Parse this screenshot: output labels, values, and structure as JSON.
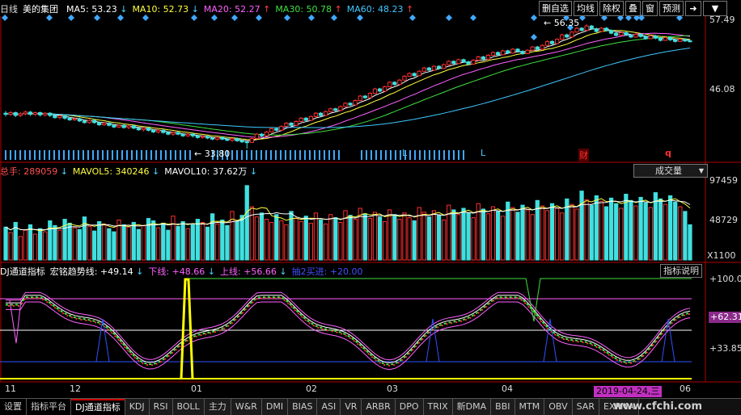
{
  "main_legend": {
    "period": "日线",
    "stock_name": "美的集团",
    "ma5": {
      "label": "MA5: 53.23",
      "arrow": "↓",
      "color": "#ffffff",
      "arrow_color": "#4fd4ff"
    },
    "ma10": {
      "label": "MA10: 52.73",
      "arrow": "↓",
      "color": "#ffff40",
      "arrow_color": "#4fd4ff"
    },
    "ma20": {
      "label": "MA20: 52.27",
      "arrow": "↑",
      "color": "#ff60ff",
      "arrow_color": "#ff4040"
    },
    "ma30": {
      "label": "MA30: 50.78",
      "arrow": "↑",
      "color": "#40e040",
      "arrow_color": "#ff4040"
    },
    "ma60": {
      "label": "MA60: 48.23",
      "arrow": "↑",
      "color": "#40c8ff",
      "arrow_color": "#ff4040"
    }
  },
  "toolbar": {
    "buttons": [
      "删自选",
      "均线",
      "除权",
      "叠",
      "窗",
      "预测"
    ],
    "icon_name": "exit-arrow-icon",
    "icon_glyph": "➜",
    "dropdown_glyph": "▼"
  },
  "price_axis": {
    "top": "57.49",
    "bottom": "46.08"
  },
  "volume_legend": {
    "total": {
      "label": "总手: 289059",
      "arrow": "↓",
      "color": "#ff5050",
      "arrow_color": "#4fd4ff"
    },
    "mavol5": {
      "label": "MAVOL5: 340246",
      "arrow": "↓",
      "color": "#ffff40",
      "arrow_color": "#4fd4ff"
    },
    "mavol10": {
      "label": "MAVOL10: 37.62万",
      "arrow": "↓",
      "color": "#ffffff",
      "arrow_color": "#4fd4ff"
    },
    "selector": "成交量",
    "selector_arrow": "▼"
  },
  "volume_axis": {
    "top": "97459",
    "mid": "48729",
    "unit": "X1100"
  },
  "indicator_legend": {
    "name": {
      "label": "DJ通道指标",
      "color": "#ffffff"
    },
    "trend": {
      "label": "宏铭趋势线: +49.14",
      "arrow": "↓",
      "color": "#ffffff",
      "arrow_color": "#4fd4ff"
    },
    "lower": {
      "label": "下线: +48.66",
      "arrow": "↓",
      "color": "#ff60ff",
      "arrow_color": "#4fd4ff"
    },
    "upper": {
      "label": "上线: +56.66",
      "arrow": "↓",
      "color": "#ff60ff",
      "arrow_color": "#4fd4ff"
    },
    "buy": {
      "label": "抽2买进: +20.00",
      "color": "#4050ff"
    },
    "help": "指标说明"
  },
  "indicator_axis": {
    "top": "+100.0",
    "current": "+62.31",
    "low": "+33.85"
  },
  "x_axis": {
    "labels": [
      "11",
      "12",
      "01",
      "02",
      "03",
      "04",
      "06"
    ],
    "date_badge": "2019-04-24,三"
  },
  "annotations": {
    "high_label": "56.35",
    "low_label": "33.80",
    "marker_cai": "财",
    "marker_l1": "L",
    "marker_l2": "L",
    "marker_q": "q"
  },
  "tabs": [
    "设置",
    "指标平台",
    "DJ通道指标",
    "KDJ",
    "RSI",
    "BOLL",
    "主力",
    "W&R",
    "DMI",
    "BIAS",
    "ASI",
    "VR",
    "ARBR",
    "DPO",
    "TRIX",
    "新DMA",
    "BBI",
    "MTM",
    "OBV",
    "SAR",
    "EXPMA"
  ],
  "active_tab": "DJ通道指标",
  "watermark": "www.cfchi.com",
  "chart_data": {
    "type": "candlestick",
    "title": "美的集团",
    "ylim": [
      44.0,
      58.5
    ],
    "price_labels": [
      57.49,
      46.08
    ],
    "candles": [
      [
        40.2,
        40.0,
        40.6,
        39.6
      ],
      [
        40.0,
        40.3,
        40.6,
        39.7
      ],
      [
        40.3,
        39.8,
        40.5,
        39.5
      ],
      [
        39.8,
        40.1,
        40.4,
        39.5
      ],
      [
        40.1,
        40.4,
        40.7,
        39.8
      ],
      [
        40.4,
        40.0,
        40.6,
        39.7
      ],
      [
        40.0,
        40.3,
        40.5,
        39.7
      ],
      [
        40.3,
        39.9,
        40.5,
        39.6
      ],
      [
        39.9,
        40.2,
        40.4,
        39.6
      ],
      [
        40.2,
        39.8,
        40.4,
        39.5
      ],
      [
        39.8,
        39.4,
        40.0,
        39.2
      ],
      [
        39.4,
        39.7,
        39.9,
        39.1
      ],
      [
        39.7,
        39.3,
        39.9,
        39.0
      ],
      [
        39.3,
        39.0,
        39.5,
        38.8
      ],
      [
        39.0,
        39.2,
        39.4,
        38.8
      ],
      [
        39.2,
        38.8,
        39.4,
        38.6
      ],
      [
        38.8,
        38.5,
        39.0,
        38.3
      ],
      [
        38.5,
        38.9,
        39.1,
        38.3
      ],
      [
        38.9,
        38.5,
        39.1,
        38.3
      ],
      [
        38.5,
        38.1,
        38.7,
        37.9
      ],
      [
        38.1,
        38.4,
        38.6,
        37.9
      ],
      [
        38.4,
        38.0,
        38.6,
        37.8
      ],
      [
        38.0,
        37.7,
        38.2,
        37.5
      ],
      [
        37.7,
        38.0,
        38.2,
        37.5
      ],
      [
        38.0,
        37.6,
        38.2,
        37.4
      ],
      [
        37.6,
        37.9,
        38.1,
        37.3
      ],
      [
        37.9,
        37.5,
        38.1,
        37.3
      ],
      [
        37.5,
        37.2,
        37.7,
        37.0
      ],
      [
        37.2,
        37.5,
        37.7,
        36.9
      ],
      [
        37.5,
        37.1,
        37.7,
        36.9
      ],
      [
        37.1,
        36.8,
        37.3,
        36.6
      ],
      [
        36.8,
        37.1,
        37.3,
        36.5
      ],
      [
        37.1,
        36.7,
        37.3,
        36.5
      ],
      [
        36.7,
        36.4,
        36.9,
        36.2
      ],
      [
        36.4,
        36.7,
        36.9,
        36.1
      ],
      [
        36.7,
        36.4,
        36.9,
        36.2
      ],
      [
        36.4,
        36.1,
        36.6,
        35.9
      ],
      [
        36.1,
        36.4,
        36.6,
        35.9
      ],
      [
        36.4,
        36.1,
        36.6,
        35.8
      ],
      [
        36.1,
        35.8,
        36.3,
        35.6
      ],
      [
        35.8,
        36.0,
        36.2,
        35.6
      ],
      [
        36.0,
        35.7,
        36.2,
        35.5
      ],
      [
        35.7,
        35.5,
        35.9,
        35.3
      ],
      [
        35.5,
        35.8,
        36.0,
        35.2
      ],
      [
        35.8,
        35.5,
        36.0,
        35.3
      ],
      [
        35.5,
        35.3,
        35.7,
        35.1
      ],
      [
        35.3,
        35.6,
        35.8,
        35.0
      ],
      [
        35.6,
        35.2,
        35.8,
        35.0
      ],
      [
        35.2,
        35.0,
        35.4,
        34.8
      ],
      [
        35.0,
        34.9,
        35.2,
        33.8
      ],
      [
        34.9,
        35.6,
        35.8,
        34.8
      ],
      [
        35.6,
        36.4,
        36.6,
        35.5
      ],
      [
        36.4,
        36.1,
        36.6,
        35.9
      ],
      [
        36.1,
        36.8,
        37.0,
        36.0
      ],
      [
        36.8,
        37.4,
        37.6,
        36.7
      ],
      [
        37.4,
        37.1,
        37.6,
        36.9
      ],
      [
        37.1,
        37.8,
        38.0,
        37.0
      ],
      [
        37.8,
        38.4,
        38.6,
        37.7
      ],
      [
        38.4,
        38.0,
        38.6,
        37.8
      ],
      [
        38.0,
        38.7,
        38.9,
        37.9
      ],
      [
        38.7,
        39.3,
        39.5,
        38.6
      ],
      [
        39.3,
        38.9,
        39.5,
        38.7
      ],
      [
        38.9,
        39.6,
        39.8,
        38.8
      ],
      [
        39.6,
        40.2,
        40.4,
        39.5
      ],
      [
        40.2,
        39.8,
        40.4,
        39.6
      ],
      [
        39.8,
        40.5,
        40.7,
        39.7
      ],
      [
        40.5,
        41.0,
        41.2,
        40.4
      ],
      [
        41.0,
        40.7,
        41.2,
        40.5
      ],
      [
        40.7,
        41.4,
        41.6,
        40.6
      ],
      [
        41.4,
        42.0,
        42.2,
        41.3
      ],
      [
        42.0,
        41.7,
        42.2,
        41.5
      ],
      [
        41.7,
        42.5,
        42.7,
        41.6
      ],
      [
        42.5,
        43.3,
        43.5,
        42.4
      ],
      [
        43.3,
        43.0,
        43.5,
        42.8
      ],
      [
        43.0,
        43.8,
        44.0,
        42.9
      ],
      [
        43.8,
        44.6,
        44.8,
        43.7
      ],
      [
        44.6,
        44.2,
        44.8,
        44.0
      ],
      [
        44.2,
        45.0,
        45.2,
        44.1
      ],
      [
        45.0,
        45.8,
        46.0,
        44.9
      ],
      [
        45.8,
        45.4,
        46.0,
        45.2
      ],
      [
        45.4,
        46.2,
        46.4,
        45.3
      ],
      [
        46.2,
        46.9,
        47.1,
        46.1
      ],
      [
        46.9,
        47.4,
        47.6,
        46.8
      ],
      [
        47.4,
        47.0,
        47.6,
        46.8
      ],
      [
        47.0,
        47.8,
        48.0,
        46.9
      ],
      [
        47.8,
        48.4,
        48.6,
        47.7
      ],
      [
        48.4,
        48.0,
        48.6,
        47.8
      ],
      [
        48.0,
        48.7,
        48.9,
        47.9
      ],
      [
        48.7,
        48.3,
        48.9,
        48.1
      ],
      [
        48.3,
        49.0,
        49.2,
        48.2
      ],
      [
        49.0,
        49.6,
        49.8,
        48.9
      ],
      [
        49.6,
        49.2,
        49.8,
        49.0
      ],
      [
        49.2,
        49.9,
        50.1,
        49.1
      ],
      [
        49.9,
        49.5,
        50.1,
        49.3
      ],
      [
        49.5,
        49.1,
        49.7,
        48.9
      ],
      [
        49.1,
        49.8,
        50.0,
        49.0
      ],
      [
        49.8,
        50.4,
        50.6,
        49.7
      ],
      [
        50.4,
        50.0,
        50.6,
        49.8
      ],
      [
        50.0,
        50.7,
        50.9,
        49.9
      ],
      [
        50.7,
        51.2,
        51.4,
        50.6
      ],
      [
        51.2,
        50.8,
        51.4,
        50.6
      ],
      [
        50.8,
        51.5,
        51.7,
        50.7
      ],
      [
        51.5,
        51.1,
        51.7,
        50.9
      ],
      [
        51.1,
        51.8,
        52.0,
        51.0
      ],
      [
        51.8,
        51.4,
        52.0,
        51.2
      ],
      [
        51.4,
        51.0,
        51.6,
        50.8
      ],
      [
        51.0,
        51.6,
        51.8,
        50.9
      ],
      [
        51.6,
        52.2,
        52.4,
        51.5
      ],
      [
        52.2,
        51.8,
        52.4,
        51.6
      ],
      [
        51.8,
        52.5,
        52.7,
        51.7
      ],
      [
        52.5,
        53.2,
        53.4,
        52.4
      ],
      [
        53.2,
        52.8,
        53.4,
        52.6
      ],
      [
        52.8,
        53.6,
        53.8,
        52.7
      ],
      [
        53.6,
        54.4,
        54.6,
        53.5
      ],
      [
        54.4,
        54.0,
        54.6,
        53.8
      ],
      [
        54.0,
        54.9,
        55.1,
        53.9
      ],
      [
        54.9,
        55.6,
        55.8,
        54.8
      ],
      [
        55.6,
        55.2,
        55.8,
        55.0
      ],
      [
        55.2,
        56.0,
        56.35,
        55.1
      ],
      [
        56.0,
        55.5,
        56.2,
        55.3
      ],
      [
        55.5,
        55.0,
        55.7,
        54.8
      ],
      [
        55.0,
        55.6,
        55.8,
        54.9
      ],
      [
        55.6,
        55.2,
        55.8,
        55.0
      ],
      [
        55.2,
        54.7,
        55.4,
        54.5
      ],
      [
        54.7,
        54.3,
        54.9,
        54.1
      ],
      [
        54.3,
        54.8,
        55.0,
        54.2
      ],
      [
        54.8,
        54.4,
        55.0,
        54.2
      ],
      [
        54.4,
        54.0,
        54.6,
        53.8
      ],
      [
        54.0,
        54.5,
        54.7,
        53.9
      ],
      [
        54.5,
        54.1,
        54.7,
        53.9
      ],
      [
        54.1,
        53.7,
        54.3,
        53.5
      ],
      [
        53.7,
        54.2,
        54.4,
        53.6
      ],
      [
        54.2,
        53.8,
        54.4,
        53.6
      ],
      [
        53.8,
        53.4,
        54.0,
        53.2
      ],
      [
        53.4,
        53.9,
        54.1,
        53.3
      ],
      [
        53.9,
        53.5,
        54.1,
        53.3
      ],
      [
        53.5,
        53.2,
        53.7,
        53.0
      ],
      [
        53.2,
        53.6,
        53.8,
        53.1
      ],
      [
        53.6,
        53.3,
        53.8,
        53.1
      ],
      [
        53.3,
        53.2,
        53.6,
        53.0
      ]
    ],
    "volume": [
      42,
      35,
      48,
      30,
      38,
      45,
      33,
      40,
      36,
      50,
      44,
      38,
      52,
      47,
      41,
      39,
      55,
      43,
      37,
      49,
      46,
      40,
      36,
      51,
      45,
      42,
      48,
      39,
      44,
      53,
      50,
      41,
      47,
      38,
      56,
      43,
      49,
      40,
      45,
      52,
      48,
      42,
      59,
      46,
      51,
      44,
      62,
      49,
      57,
      95,
      68,
      55,
      60,
      52,
      48,
      58,
      50,
      45,
      62,
      53,
      49,
      56,
      47,
      60,
      51,
      46,
      58,
      54,
      48,
      63,
      57,
      52,
      66,
      59,
      53,
      61,
      55,
      49,
      64,
      58,
      52,
      60,
      54,
      50,
      67,
      61,
      55,
      63,
      57,
      51,
      70,
      64,
      58,
      66,
      60,
      54,
      72,
      65,
      59,
      68,
      62,
      56,
      74,
      67,
      61,
      70,
      64,
      58,
      76,
      69,
      63,
      72,
      66,
      60,
      78,
      71,
      65,
      88,
      77,
      70,
      82,
      75,
      68,
      79,
      72,
      66,
      84,
      76,
      69,
      80,
      73,
      67,
      86,
      78,
      71,
      82,
      74,
      68,
      62,
      45
    ],
    "volume_labels": [
      97459,
      48729
    ],
    "indicator_labels": [
      100.0,
      62.31,
      33.85
    ],
    "x_labels": [
      "11",
      "12",
      "01",
      "02",
      "03",
      "04",
      "06"
    ]
  }
}
